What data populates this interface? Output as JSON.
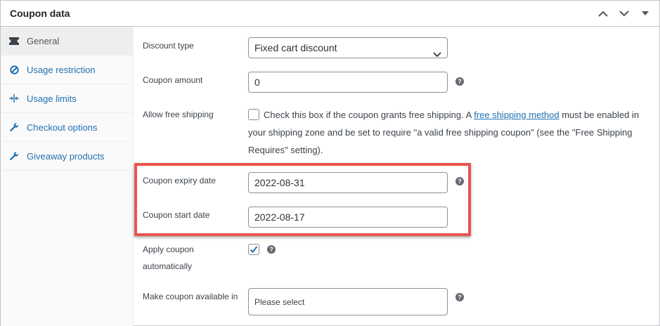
{
  "header": {
    "title": "Coupon data",
    "icons": [
      "chevron-up-icon",
      "chevron-down-icon",
      "caret-down-icon"
    ]
  },
  "sidebar": {
    "items": [
      {
        "label": "General",
        "icon": "ticket-icon",
        "active": true
      },
      {
        "label": "Usage restriction",
        "icon": "prohibited-icon",
        "active": false
      },
      {
        "label": "Usage limits",
        "icon": "arrows-icon",
        "active": false
      },
      {
        "label": "Checkout options",
        "icon": "wrench-icon",
        "active": false
      },
      {
        "label": "Giveaway products",
        "icon": "wrench-icon",
        "active": false
      }
    ]
  },
  "form": {
    "discount_type": {
      "label": "Discount type",
      "value": "Fixed cart discount"
    },
    "coupon_amount": {
      "label": "Coupon amount",
      "value": "0"
    },
    "free_shipping": {
      "label": "Allow free shipping",
      "checked": false,
      "desc_before": "Check this box if the coupon grants free shipping. A ",
      "link_text": "free shipping method",
      "desc_after": " must be enabled in your shipping zone and be set to require \"a valid free shipping coupon\" (see the \"Free Shipping Requires\" setting)."
    },
    "expiry_date": {
      "label": "Coupon expiry date",
      "value": "2022-08-31"
    },
    "start_date": {
      "label": "Coupon start date",
      "value": "2022-08-17"
    },
    "apply_auto": {
      "label_line1": "Apply coupon",
      "label_line2": "automatically",
      "checked": true
    },
    "available_in": {
      "label": "Make coupon available in",
      "placeholder": "Please select"
    },
    "help_glyph": "?"
  },
  "colors": {
    "link": "#2271b1",
    "highlight_border": "#e8554e",
    "checkbox_check": "#2271b1"
  }
}
